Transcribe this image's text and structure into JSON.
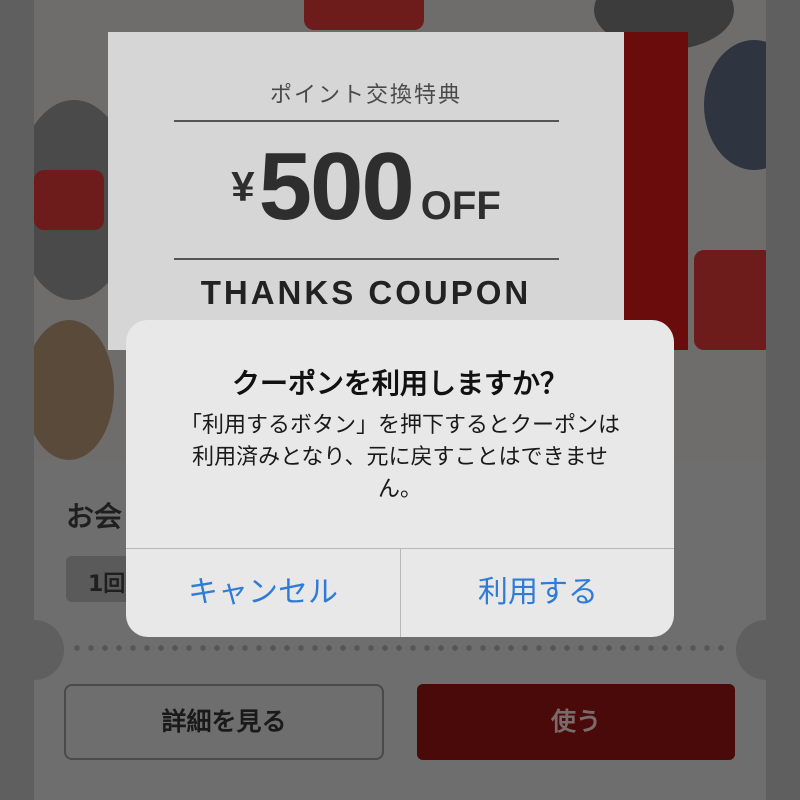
{
  "coupon": {
    "subtitle": "ポイント交換特典",
    "yen": "¥",
    "amount": "500",
    "off": "OFF",
    "thanks": "THANKS COUPON"
  },
  "page": {
    "heading": "お会",
    "chip": "1回",
    "detail_button": "詳細を見る",
    "use_button": "使う"
  },
  "alert": {
    "title": "クーポンを利用しますか？",
    "message": "「利用するボタン」を押下するとクーポンは利用済みとなり、元に戻すことはできません。",
    "cancel_label": "キャンセル",
    "confirm_label": "利用する"
  },
  "colors": {
    "accent": "#2f7bd6",
    "coupon_strip": "#8b1a1a",
    "use_button": "#8b1a1a"
  }
}
